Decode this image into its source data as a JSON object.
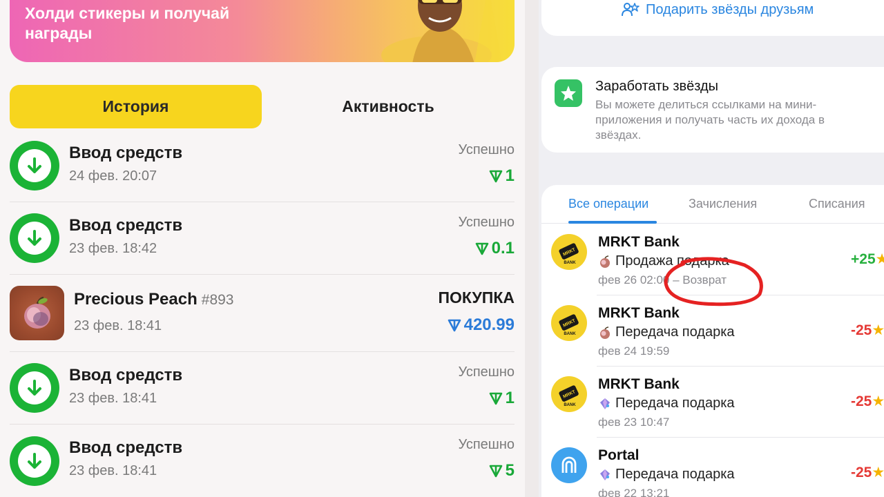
{
  "banner": {
    "line1": "Холди стикеры и получай",
    "line2": "награды"
  },
  "left_tabs": {
    "history": "История",
    "activity": "Активность"
  },
  "history": [
    {
      "title": "Ввод средств",
      "date": "24 фев. 20:07",
      "status": "Успешно",
      "amount": "1",
      "type": "deposit"
    },
    {
      "title": "Ввод средств",
      "date": "23 фев. 18:42",
      "status": "Успешно",
      "amount": "0.1",
      "type": "deposit"
    },
    {
      "title": "Precious Peach",
      "number": "#893",
      "date": "23 фев. 18:41",
      "status": "ПОКУПКА",
      "amount": "420.99",
      "type": "purchase"
    },
    {
      "title": "Ввод средств",
      "date": "23 фев. 18:41",
      "status": "Успешно",
      "amount": "1",
      "type": "deposit"
    },
    {
      "title": "Ввод средств",
      "date": "23 фев. 18:41",
      "status": "Успешно",
      "amount": "5",
      "type": "deposit"
    }
  ],
  "gift_card": {
    "link": "Подарить звёзды друзьям"
  },
  "earn_card": {
    "title": "Заработать звёзды",
    "desc_line1": "Вы можете делиться ссылками на мини-",
    "desc_line2": "приложения и получать часть их дохода в",
    "desc_line3": "звёздах."
  },
  "ops_tabs": {
    "all": "Все операции",
    "income": "Зачисления",
    "expense": "Списания"
  },
  "transactions": [
    {
      "name": "MRKT Bank",
      "desc": "Продажа подарка",
      "date": "фев 26 02:00 – Возврат",
      "amount": "+25",
      "avatar": "mrkt",
      "gift": "peach"
    },
    {
      "name": "MRKT Bank",
      "desc": "Передача подарка",
      "date": "фев 24 19:59",
      "amount": "-25",
      "avatar": "mrkt",
      "gift": "peach"
    },
    {
      "name": "MRKT Bank",
      "desc": "Передача подарка",
      "date": "фев 23 10:47",
      "amount": "-25",
      "avatar": "mrkt",
      "gift": "crystal"
    },
    {
      "name": "Portal",
      "desc": "Передача подарка",
      "date": "фев 22 13:21",
      "amount": "-25",
      "avatar": "portal",
      "gift": "crystal"
    }
  ],
  "mrkt_logo_text": "MRKT",
  "mrkt_logo_sub": "BANK",
  "colors": {
    "accent_blue": "#2a86e0",
    "green": "#1bb336",
    "tab_yellow": "#f7d51e",
    "negative": "#e53935",
    "annotation": "#e52222"
  }
}
